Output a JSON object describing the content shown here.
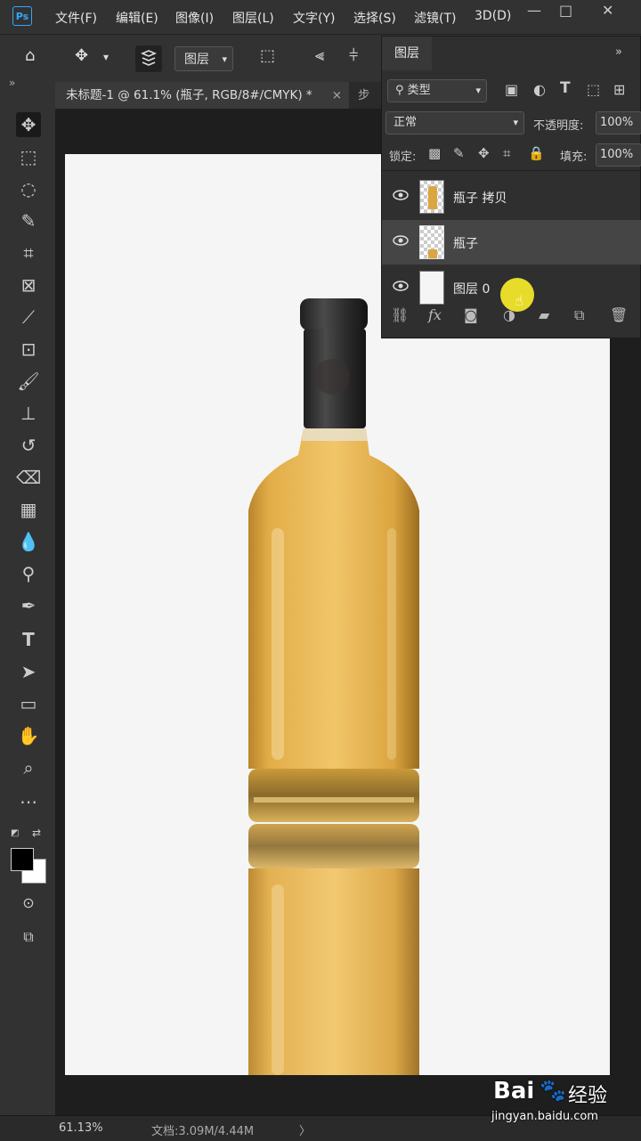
{
  "app": {
    "logo": "Ps"
  },
  "menubar": {
    "items": [
      "文件(F)",
      "编辑(E)",
      "图像(I)",
      "图层(L)",
      "文字(Y)",
      "选择(S)",
      "滤镜(T)",
      "3D(D)"
    ],
    "window_controls": {
      "minimize": "—",
      "restore": "□",
      "close": "✕"
    }
  },
  "optionsbar": {
    "auto_select_value": "图层"
  },
  "tabs": [
    {
      "label": "未标题-1 @ 61.1% (瓶子, RGB/8#/CMYK) *",
      "close": "×"
    },
    {
      "label": "步"
    }
  ],
  "toolbar": {
    "collapse_label": "»"
  },
  "layers_panel": {
    "title": "图层",
    "collapse_label": "»",
    "filter_label": "类型",
    "blend_mode": "正常",
    "opacity_label": "不透明度:",
    "opacity_value": "100%",
    "lock_label": "锁定:",
    "fill_label": "填充:",
    "fill_value": "100%",
    "layers": [
      {
        "name": "瓶子 拷贝",
        "selected": false
      },
      {
        "name": "瓶子",
        "selected": true
      },
      {
        "name": "图层 0",
        "selected": false
      }
    ],
    "footer": {
      "fx": "fx"
    }
  },
  "statusbar": {
    "zoom": "61.13%",
    "doc_info": "文档:3.09M/4.44M",
    "arrow": "〉"
  },
  "watermark": {
    "brand": "Bai",
    "brand_suffix": "经验",
    "url": "jingyan.baidu.com"
  },
  "colors": {
    "accent": "#31a8ff",
    "panel_bg": "#2f2f2f",
    "app_bg": "#323232",
    "cursor_highlight": "#f2e62a",
    "bottle_liquid": "#e8b94c",
    "bottle_cap": "#2a2a2a"
  }
}
